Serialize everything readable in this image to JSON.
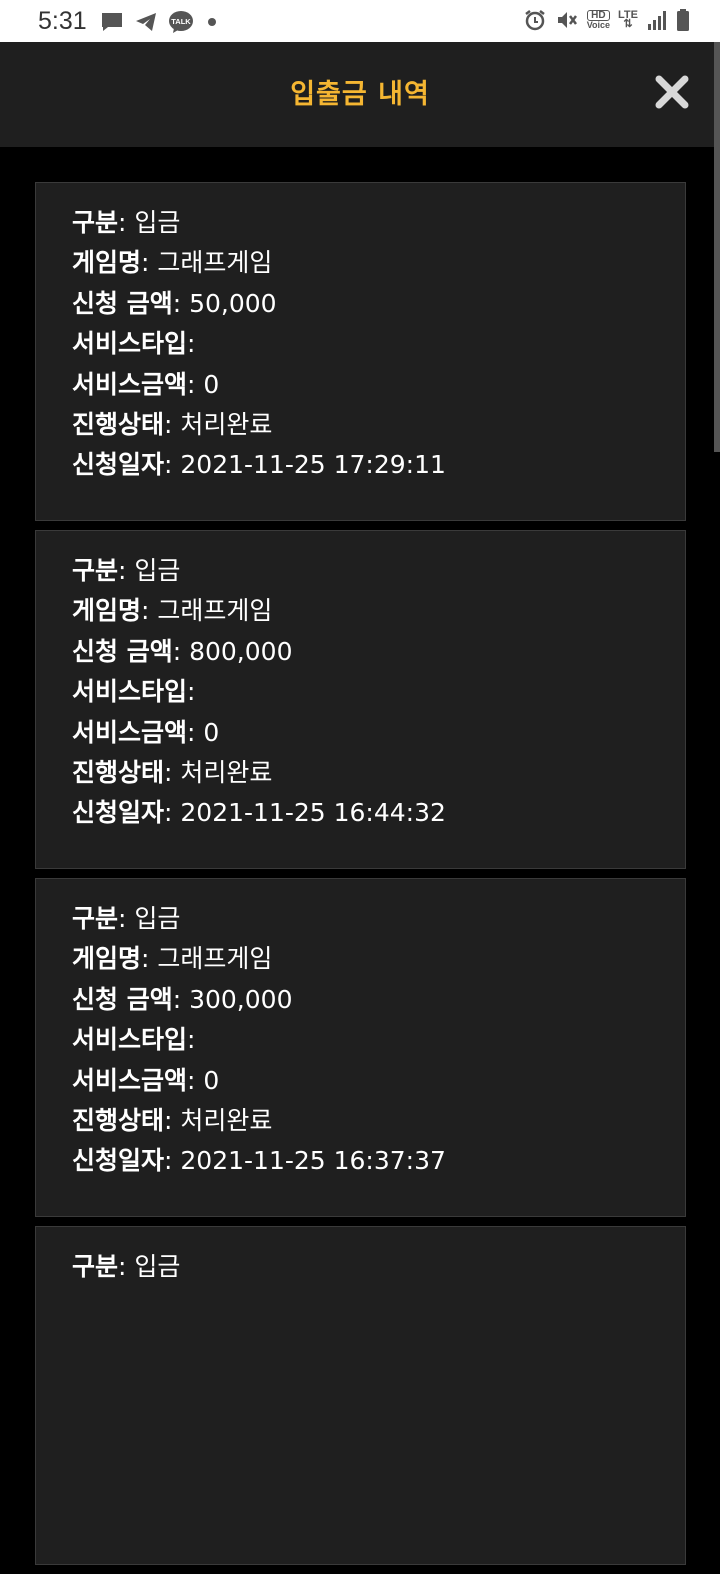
{
  "status_bar": {
    "time": "5:31",
    "left_icons": [
      "message-icon",
      "telegram-icon",
      "kakaotalk-icon",
      "dot-icon"
    ],
    "kakao_label": "TALK",
    "right_icons": [
      "alarm-icon",
      "mute-icon",
      "hd-voice-icon",
      "lte-icon",
      "signal-icon",
      "battery-icon"
    ],
    "hd_label": "HD",
    "voice_label": "Voice",
    "lte_label": "LTE"
  },
  "header": {
    "title": "입출금 내역",
    "close_icon": "close-icon",
    "title_color": "#f5b632"
  },
  "labels": {
    "type": "구분",
    "game": "게임명",
    "amount": "신청 금액",
    "service_type": "서비스타입",
    "service_amount": "서비스금액",
    "status": "진행상태",
    "date": "신청일자"
  },
  "records": [
    {
      "type": "입금",
      "game": "그래프게임",
      "amount": "50,000",
      "service_type": "",
      "service_amount": "0",
      "status": "처리완료",
      "date": "2021-11-25 17:29:11"
    },
    {
      "type": "입금",
      "game": "그래프게임",
      "amount": "800,000",
      "service_type": "",
      "service_amount": "0",
      "status": "처리완료",
      "date": "2021-11-25 16:44:32"
    },
    {
      "type": "입금",
      "game": "그래프게임",
      "amount": "300,000",
      "service_type": "",
      "service_amount": "0",
      "status": "처리완료",
      "date": "2021-11-25 16:37:37"
    },
    {
      "type": "입금"
    }
  ]
}
